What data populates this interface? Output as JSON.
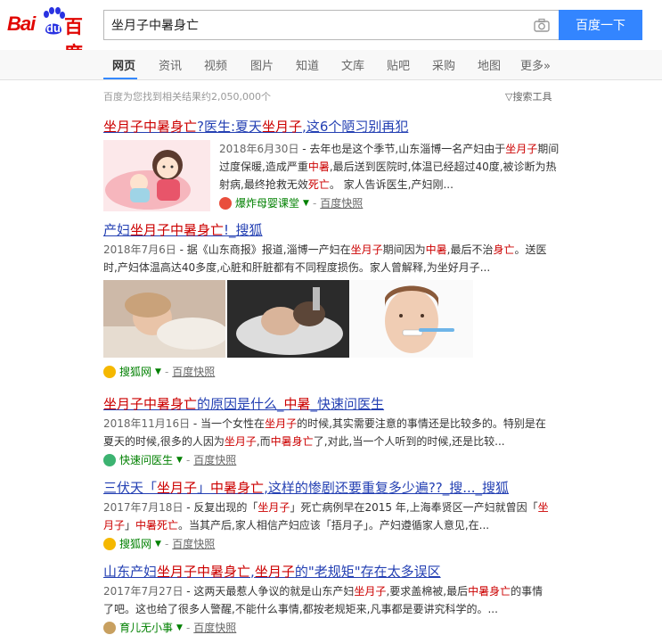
{
  "header": {
    "logo_bai": "Bai",
    "logo_du": "du",
    "logo_cn": "百度",
    "search_value": "坐月子中暑身亡",
    "search_button": "百度一下"
  },
  "nav": {
    "tabs": [
      "网页",
      "资讯",
      "视频",
      "图片",
      "知道",
      "文库",
      "贴吧",
      "采购",
      "地图",
      "更多»"
    ]
  },
  "stats": {
    "count_text": "百度为您找到相关结果约2,050,000个",
    "tools_label": "搜索工具"
  },
  "results": [
    {
      "title_parts": [
        "坐月子中暑身亡",
        "?医生:夏天",
        "坐月子",
        ",这6个陋习别再犯"
      ],
      "date": "2018年6月30日",
      "abstract_parts": [
        " - 去年也是这个季节,山东淄博一名产妇由于",
        "坐月子",
        "期间过度保暖,造成严重",
        "中暑",
        ",最后送到医院时,体温已经超过40度,被诊断为热射病,最终抢救无效",
        "死亡",
        "。 家人告诉医生,产妇刚..."
      ],
      "source": "爆炸母婴课堂",
      "cache": "百度快照"
    },
    {
      "title_parts": [
        "产妇",
        "坐月子中暑身亡",
        "!_搜狐"
      ],
      "date": "2018年7月6日",
      "abstract_parts": [
        " - 据《山东商报》报道,淄博一产妇在",
        "坐月子",
        "期间因为",
        "中暑",
        ",最后不治",
        "身亡",
        "。送医时,产妇体温高达40多度,心脏和肝脏都有不同程度损伤。家人曾解释,为坐好月子..."
      ],
      "source": "搜狐网",
      "cache": "百度快照"
    },
    {
      "title_parts": [
        "坐月子中暑身亡",
        "的原因是什么_",
        "中暑",
        "_快速问医生"
      ],
      "date": "2018年11月16日",
      "abstract_parts": [
        " - 当一个女性在",
        "坐月子",
        "的时候,其实需要注意的事情还是比较多的。特别是在夏天的时候,很多的人因为",
        "坐月子",
        ",而",
        "中暑身亡",
        "了,对此,当一个人听到的时候,还是比较..."
      ],
      "source": "快速问医生",
      "cache": "百度快照"
    },
    {
      "title_parts": [
        "三伏天「",
        "坐月子",
        "」",
        "中暑身亡",
        ",这样的惨剧还要重复多少遍??_搜..._搜狐"
      ],
      "date": "2017年7月18日",
      "abstract_parts": [
        " - 反复出现的「",
        "坐月子",
        "」死亡病例早在2015 年,上海奉贤区一产妇就曾因「",
        "坐月子",
        "」",
        "中暑死亡",
        "。当其产后,家人相信产妇应该「捂月子」。产妇遵循家人意见,在..."
      ],
      "source": "搜狐网",
      "cache": "百度快照"
    },
    {
      "title_parts": [
        "山东产妇",
        "坐月子中暑身亡",
        ",",
        "坐月子",
        "的\"老规矩\"存在太多误区"
      ],
      "date": "2017年7月27日",
      "abstract_parts": [
        " - 这两天最惹人争议的就是山东产妇",
        "坐月子",
        ",要求盖棉被,最后",
        "中暑身亡",
        "的事情了吧。这也给了很多人警醒,不能什么事情,都按老规矩来,凡事都是要讲究科学的。..."
      ],
      "source": "育儿无小事",
      "cache": "百度快照"
    }
  ],
  "colors": {
    "link": "#2440b3",
    "highlight": "#c00000",
    "source_green": "#008000",
    "search_button": "#3385ff",
    "logo_red": "#e10602",
    "logo_blue": "#2932e1"
  }
}
